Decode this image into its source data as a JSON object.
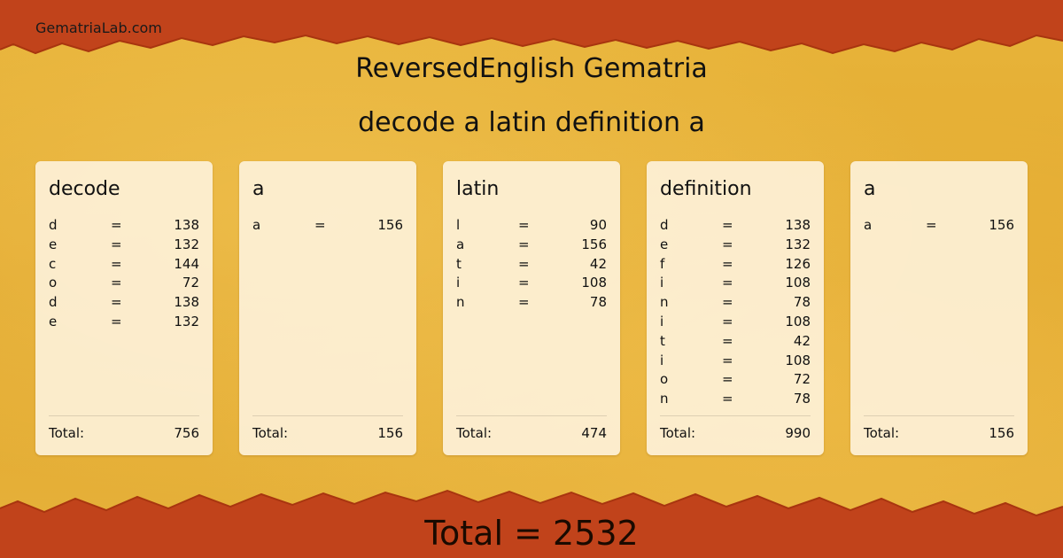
{
  "site": {
    "name": "GematriaLab.com"
  },
  "header": {
    "title": "ReversedEnglish Gematria",
    "phrase": "decode a latin definition a"
  },
  "colors": {
    "border_red": "#c1431b",
    "border_dark": "#a8350f",
    "paper": "#e3ab33",
    "card": "#fdf1d8"
  },
  "cards": [
    {
      "word": "decode",
      "rows": [
        {
          "letter": "d",
          "eq": "=",
          "value": "138"
        },
        {
          "letter": "e",
          "eq": "=",
          "value": "132"
        },
        {
          "letter": "c",
          "eq": "=",
          "value": "144"
        },
        {
          "letter": "o",
          "eq": "=",
          "value": "72"
        },
        {
          "letter": "d",
          "eq": "=",
          "value": "138"
        },
        {
          "letter": "e",
          "eq": "=",
          "value": "132"
        }
      ],
      "total_label": "Total:",
      "total": "756"
    },
    {
      "word": "a",
      "rows": [
        {
          "letter": "a",
          "eq": "=",
          "value": "156"
        }
      ],
      "total_label": "Total:",
      "total": "156"
    },
    {
      "word": "latin",
      "rows": [
        {
          "letter": "l",
          "eq": "=",
          "value": "90"
        },
        {
          "letter": "a",
          "eq": "=",
          "value": "156"
        },
        {
          "letter": "t",
          "eq": "=",
          "value": "42"
        },
        {
          "letter": "i",
          "eq": "=",
          "value": "108"
        },
        {
          "letter": "n",
          "eq": "=",
          "value": "78"
        }
      ],
      "total_label": "Total:",
      "total": "474"
    },
    {
      "word": "definition",
      "rows": [
        {
          "letter": "d",
          "eq": "=",
          "value": "138"
        },
        {
          "letter": "e",
          "eq": "=",
          "value": "132"
        },
        {
          "letter": "f",
          "eq": "=",
          "value": "126"
        },
        {
          "letter": "i",
          "eq": "=",
          "value": "108"
        },
        {
          "letter": "n",
          "eq": "=",
          "value": "78"
        },
        {
          "letter": "i",
          "eq": "=",
          "value": "108"
        },
        {
          "letter": "t",
          "eq": "=",
          "value": "42"
        },
        {
          "letter": "i",
          "eq": "=",
          "value": "108"
        },
        {
          "letter": "o",
          "eq": "=",
          "value": "72"
        },
        {
          "letter": "n",
          "eq": "=",
          "value": "78"
        }
      ],
      "total_label": "Total:",
      "total": "990"
    },
    {
      "word": "a",
      "rows": [
        {
          "letter": "a",
          "eq": "=",
          "value": "156"
        }
      ],
      "total_label": "Total:",
      "total": "156"
    }
  ],
  "footer": {
    "grand_total": "Total = 2532"
  }
}
